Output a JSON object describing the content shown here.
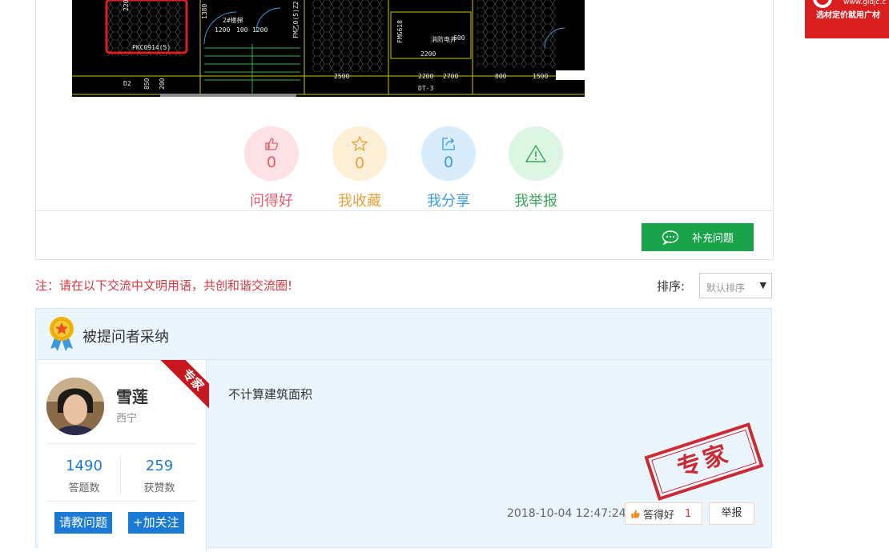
{
  "ad": {
    "url": "www.gldjc.c",
    "slogan": "选材定价就用广材"
  },
  "drawing": {
    "labels": [
      "2200",
      "1380",
      "1200",
      "100",
      "1200",
      "FM乙0(5)Z2",
      "FMG618",
      "2200",
      "600",
      "2500",
      "2700",
      "2200",
      "800",
      "1500",
      "DT-3",
      "D2",
      "850",
      "200",
      "PKC0914(5)",
      "2#楼梯",
      "消防电井"
    ]
  },
  "actions": [
    {
      "label": "问得好",
      "count": "0",
      "color": "#e85a6b",
      "bg": "#fde1e4",
      "icon": "thumbs-up-icon"
    },
    {
      "label": "我收藏",
      "count": "0",
      "color": "#e6a23c",
      "bg": "#fdefd5",
      "icon": "star-icon"
    },
    {
      "label": "我分享",
      "count": "0",
      "color": "#3a9be0",
      "bg": "#d8ecfb",
      "icon": "share-icon"
    },
    {
      "label": "我举报",
      "count": "",
      "color": "#3aa55a",
      "bg": "#ddf5e3",
      "icon": "warning-icon"
    }
  ],
  "supplement_button": "补充问题",
  "notice": "注：请在以下交流中文明用语，共创和谐交流圈!",
  "sort": {
    "label": "排序:",
    "selected": "默认排序"
  },
  "answers": {
    "header": "被提问者采纳",
    "user": {
      "name": "雪莲",
      "city": "西宁",
      "answers_count": "1490",
      "answers_caption": "答题数",
      "likes_count": "259",
      "likes_caption": "获赞数",
      "ask_button": "请教问题",
      "follow_button": "+加关注",
      "badge": "专家"
    },
    "content": "不计算建筑面积",
    "stamp": "专家",
    "time": "2018-10-04 12:47:24",
    "good_label": "答得好",
    "good_count": "1",
    "report_label": "举报"
  }
}
